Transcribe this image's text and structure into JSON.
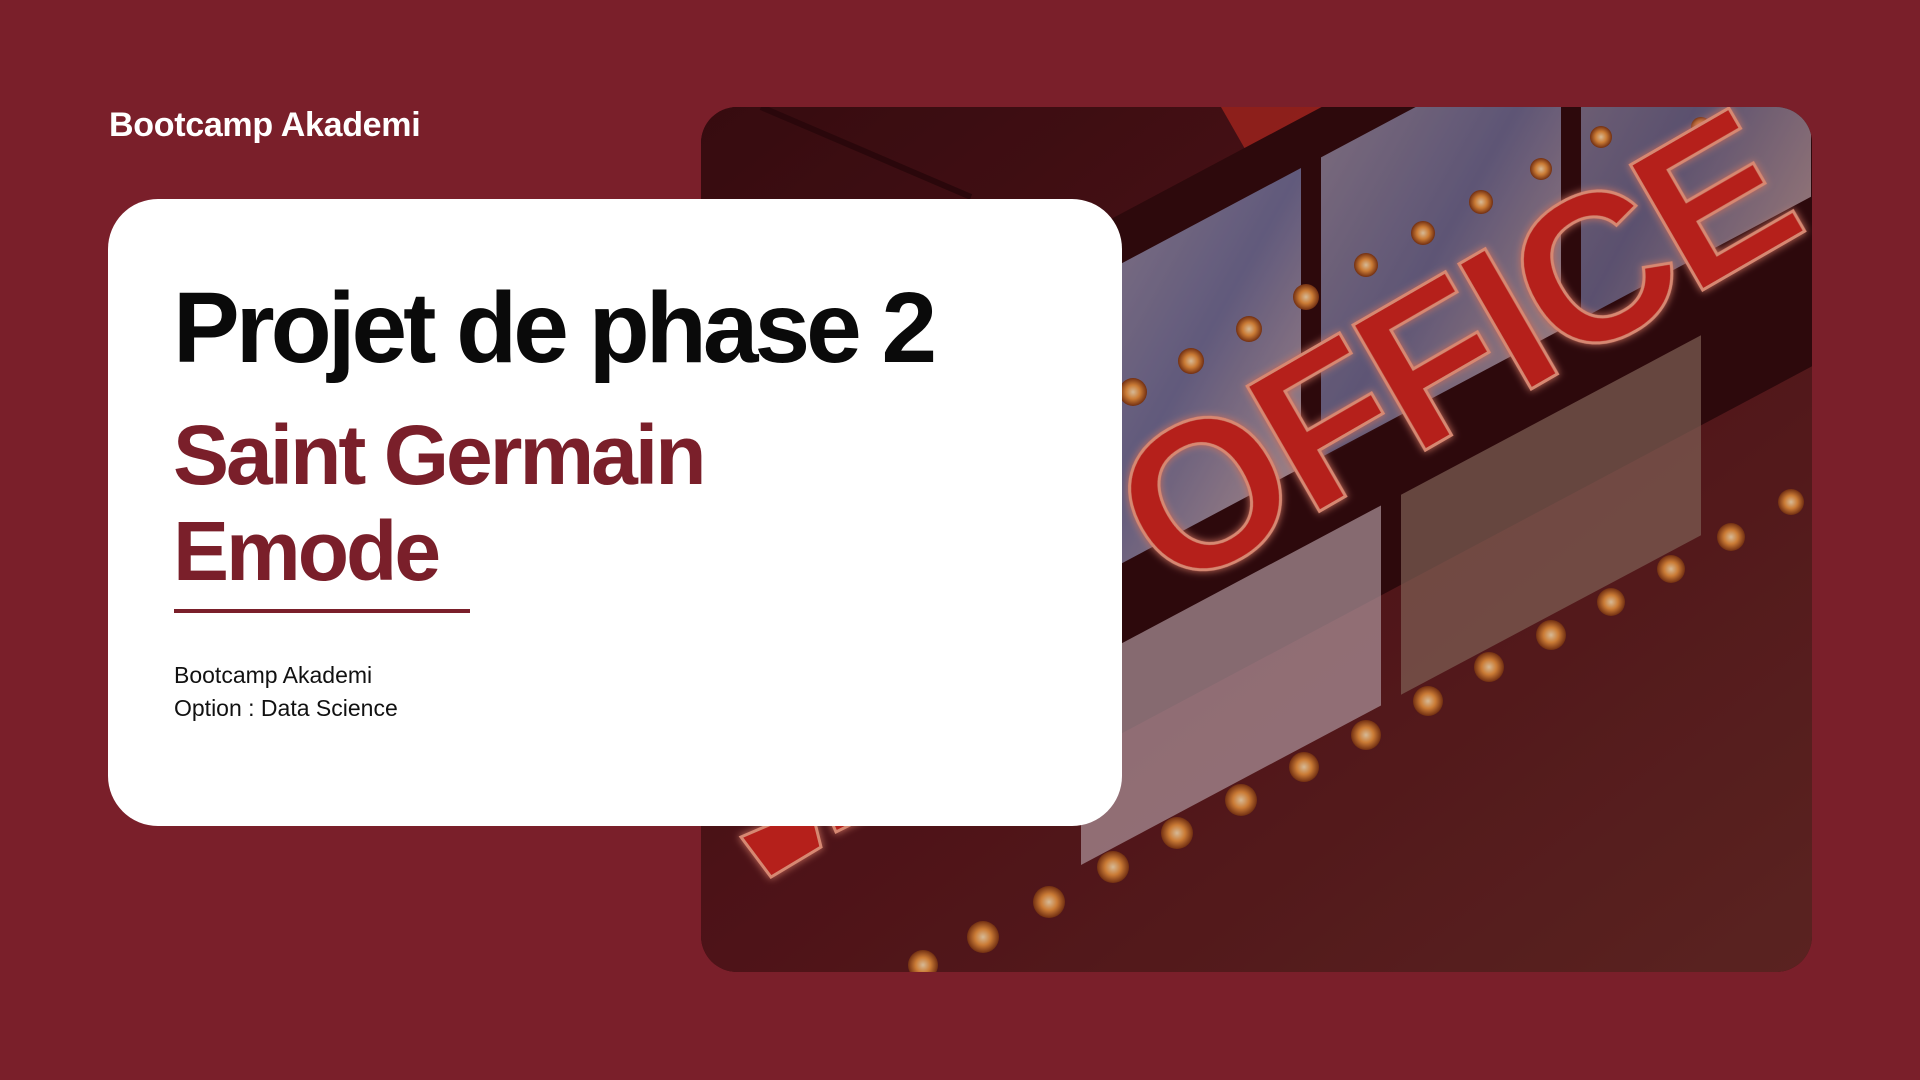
{
  "header": {
    "brand": "Bootcamp Akademi"
  },
  "card": {
    "title": "Projet de phase 2",
    "subtitle_line1": "Saint Germain",
    "subtitle_line2": "Emode",
    "meta_line1": "Bootcamp Akademi",
    "meta_line2": "Option : Data Science"
  },
  "photo": {
    "sign_text": "OFFICE",
    "description_icon": "box-office-marquee-photo"
  },
  "colors": {
    "background": "#7a1f2a",
    "accent": "#7a1f2a",
    "card": "#ffffff",
    "neon": "#e8291f"
  }
}
